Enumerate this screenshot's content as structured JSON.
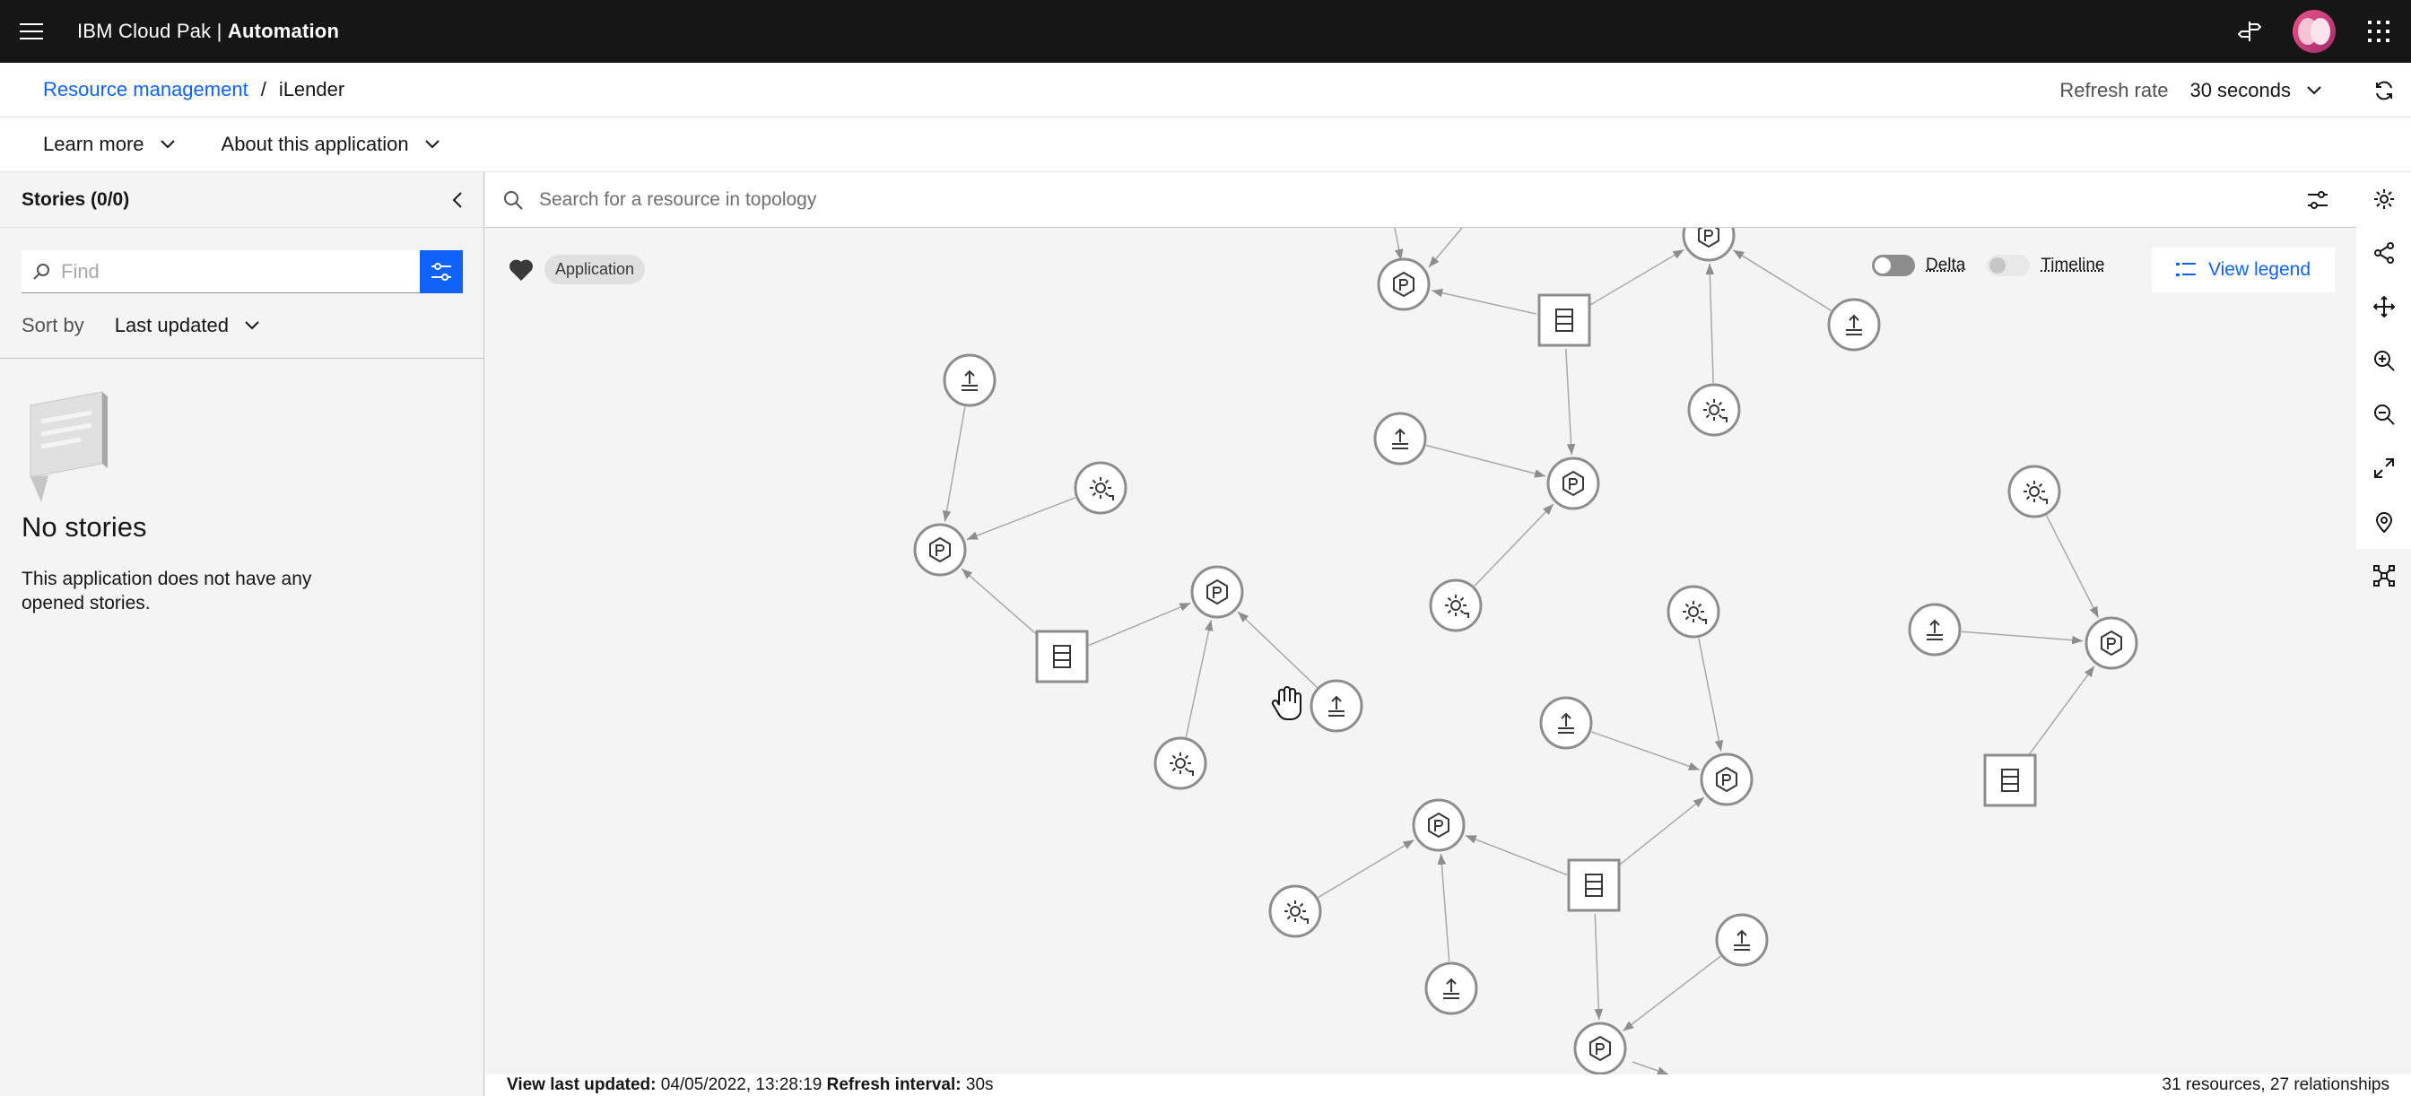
{
  "header": {
    "product": "IBM Cloud Pak",
    "separator": "|",
    "product_suffix": "Automation"
  },
  "breadcrumb": {
    "parent": "Resource management",
    "separator": "/",
    "current": "iLender"
  },
  "refresh": {
    "label": "Refresh rate",
    "value": "30 seconds"
  },
  "menu": {
    "learn_more": "Learn more",
    "about": "About this application"
  },
  "sidebar": {
    "title": "Stories (0/0)",
    "find_placeholder": "Find",
    "sort_label": "Sort by",
    "sort_value": "Last updated",
    "empty_title": "No stories",
    "empty_text": "This application does not have any opened stories."
  },
  "search": {
    "placeholder": "Search for a resource in topology"
  },
  "canvas": {
    "tag": "Application",
    "delta_label": "Delta",
    "timeline_label": "Timeline",
    "legend_label": "View legend",
    "delta_on": true,
    "timeline_on": false
  },
  "status": {
    "updated_label": "View last updated:",
    "updated_value": "04/05/2022, 13:28:19",
    "interval_label": "Refresh interval:",
    "interval_value": "30s",
    "summary": "31 resources, 27 relationships"
  },
  "colors": {
    "accent": "#0f62fe",
    "topbar": "#161616"
  }
}
